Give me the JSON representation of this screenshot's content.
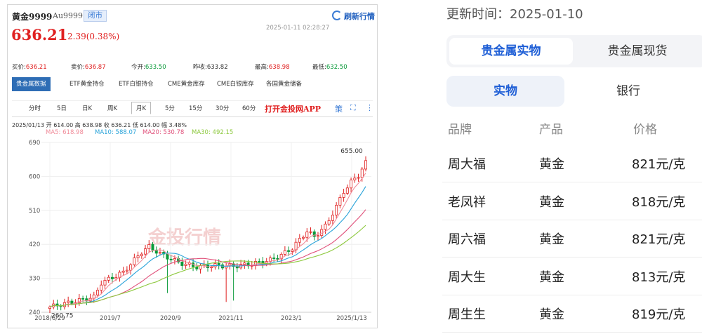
{
  "left_panel": {
    "name": "黄金9999",
    "code": "Au9999",
    "status_badge": "闭市",
    "refresh_label": "刷新行情",
    "price": "636.21",
    "change": "2.39(0.38%)",
    "timestamp": "2025-01-11 02:28:27",
    "stats": {
      "buy": {
        "label": "买价:",
        "value": "636.21"
      },
      "sell": {
        "label": "卖价:",
        "value": "636.87"
      },
      "open": {
        "label": "今开:",
        "value": "633.50"
      },
      "prev_close": {
        "label": "昨收:",
        "value": "633.82"
      },
      "high": {
        "label": "最高:",
        "value": "638.98"
      },
      "low": {
        "label": "最低:",
        "value": "632.50"
      }
    },
    "data_tabs": [
      "贵金属数据",
      "ETF黄金持仓",
      "ETF白银持仓",
      "CME黄金库存",
      "CME白银库存",
      "各国黄金储备"
    ],
    "period_tabs": [
      "分时",
      "5日",
      "日K",
      "周K",
      "月K",
      "5分",
      "15分",
      "30分",
      "60分"
    ],
    "active_period": "月K",
    "open_app_label": "打开金投网APP",
    "strategy_label": "策",
    "ohlc_line": "2025/01/13  开 614.00  高 638.98  收 636.21  低 614.00  幅 3.48%",
    "ma_labels": [
      {
        "text": "MA5: 618.98",
        "color": "#f08c9a"
      },
      {
        "text": "MA10: 588.07",
        "color": "#29a3d9"
      },
      {
        "text": "MA20: 530.78",
        "color": "#e0507a"
      },
      {
        "text": "MA30: 492.15",
        "color": "#8cc83c"
      }
    ],
    "watermark": "金投行情"
  },
  "chart_data": {
    "type": "candlestick",
    "y_ticks": [
      "690",
      "600",
      "510",
      "420",
      "330",
      "240"
    ],
    "ylim": [
      240,
      690
    ],
    "x_ticks": [
      "2018/6/29",
      "2019/7",
      "2020/9",
      "2021/11",
      "2023/1",
      "2025/1/13"
    ],
    "max_label": "655.00",
    "min_label": "260.75",
    "colors": {
      "up": "#e02020",
      "down": "#0a9a3a",
      "ma5": "#f08c9a",
      "ma10": "#29a3d9",
      "ma20": "#e0507a",
      "ma30": "#8cc83c"
    }
  },
  "right_panel": {
    "updated": "更新时间：2025-01-10",
    "main_tabs": [
      "贵金属实物",
      "贵金属现货"
    ],
    "sub_tabs": [
      "实物",
      "银行"
    ],
    "headers": [
      "品牌",
      "产品",
      "价格"
    ],
    "rows": [
      {
        "brand": "周大福",
        "product": "黄金",
        "price": "821元/克"
      },
      {
        "brand": "老凤祥",
        "product": "黄金",
        "price": "818元/克"
      },
      {
        "brand": "周六福",
        "product": "黄金",
        "price": "821元/克"
      },
      {
        "brand": "周大生",
        "product": "黄金",
        "price": "813元/克"
      },
      {
        "brand": "周生生",
        "product": "黄金",
        "price": "819元/克"
      }
    ]
  }
}
